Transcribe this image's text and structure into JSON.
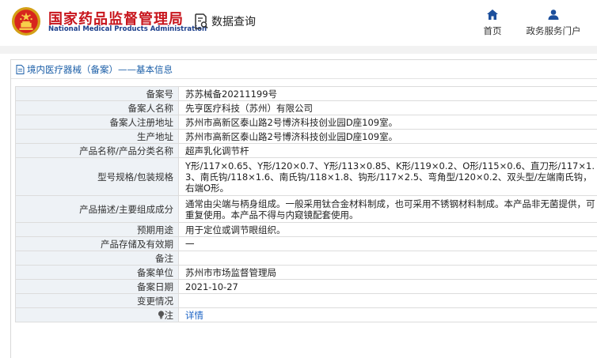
{
  "header": {
    "brand_cn": "国家药品监督管理局",
    "brand_en": "National Medical Products Administration",
    "query_label": "数据查询",
    "nav": {
      "home_label": "首页",
      "gov_label": "政务服务门户"
    }
  },
  "panel": {
    "title": "境内医疗器械（备案）——基本信息"
  },
  "details": {
    "rows": [
      {
        "label": "备案号",
        "value": "苏苏械备20211199号"
      },
      {
        "label": "备案人名称",
        "value": "先亨医疗科技（苏州）有限公司"
      },
      {
        "label": "备案人注册地址",
        "value": "苏州市高新区泰山路2号博济科技创业园D座109室。"
      },
      {
        "label": "生产地址",
        "value": "苏州市高新区泰山路2号博济科技创业园D座109室。"
      },
      {
        "label": "产品名称/产品分类名称",
        "value": "超声乳化调节杆"
      },
      {
        "label": "型号规格/包装规格",
        "value": "Y形/117×0.65、Y形/120×0.7、Y形/113×0.85、K形/119×0.2、O形/115×0.6、直刀形/117×1.3、南氏钩/118×1.6、南氏钩/118×1.8、钩形/117×2.5、弯角型/120×0.2、双头型/左端南氏钩，右端O形。"
      },
      {
        "label": "产品描述/主要组成成分",
        "value": "通常由尖端与柄身组成。一般采用钛合金材料制成，也可采用不锈钢材料制成。本产品非无菌提供，可重复使用。本产品不得与内窥镜配套使用。"
      },
      {
        "label": "预期用途",
        "value": "用于定位或调节眼组织。"
      },
      {
        "label": "产品存储及有效期",
        "value": "一"
      },
      {
        "label": "备注",
        "value": ""
      },
      {
        "label": "备案单位",
        "value": "苏州市市场监督管理局"
      },
      {
        "label": "备案日期",
        "value": "2021-10-27"
      },
      {
        "label": "变更情况",
        "value": ""
      },
      {
        "label": "注",
        "value": "详情"
      }
    ]
  },
  "colors": {
    "brand_red": "#c8161d",
    "brand_blue": "#1c3f8c",
    "link_blue": "#1a62c4",
    "label_bg": "#eef2f6"
  },
  "icons": {
    "logo": "national-emblem-icon",
    "query": "document-search-icon",
    "home": "home-icon",
    "gov": "user-icon",
    "panel": "document-icon",
    "note": "lightbulb-icon"
  }
}
